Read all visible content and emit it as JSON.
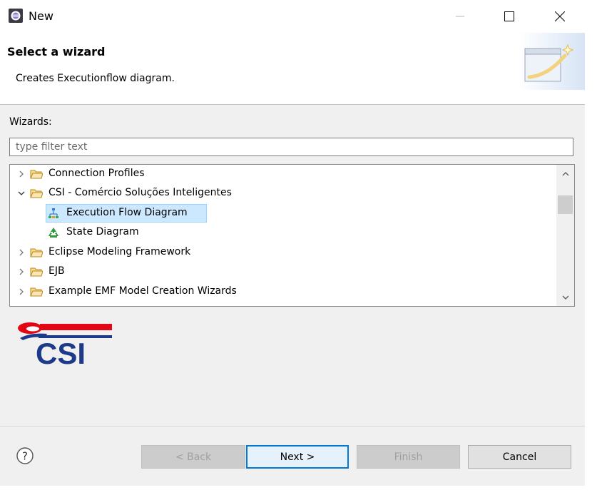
{
  "window": {
    "title": "New",
    "minimize_glyph": "—",
    "maximize_glyph": "☐",
    "close_glyph": "✕"
  },
  "header": {
    "title": "Select a wizard",
    "description": "Creates Executionflow diagram."
  },
  "wizards_label": "Wizards:",
  "filter": {
    "placeholder": "type filter text",
    "value": ""
  },
  "tree": {
    "items": [
      {
        "label": "Connection Profiles",
        "expanded": false,
        "icon": "folder-icon"
      },
      {
        "label": "CSI - Comércio Soluções Inteligentes",
        "expanded": true,
        "icon": "folder-icon"
      },
      {
        "label": "Execution Flow Diagram",
        "selected": true,
        "icon": "execution-flow-icon"
      },
      {
        "label": "State Diagram",
        "icon": "state-diagram-icon"
      },
      {
        "label": "Eclipse Modeling Framework",
        "expanded": false,
        "icon": "folder-icon"
      },
      {
        "label": "EJB",
        "expanded": false,
        "icon": "folder-icon"
      },
      {
        "label": "Example EMF Model Creation Wizards",
        "expanded": false,
        "icon": "folder-icon"
      }
    ]
  },
  "logo": {
    "text": "CSI"
  },
  "buttons": {
    "help_glyph": "?",
    "back": "< Back",
    "next": "Next >",
    "finish": "Finish",
    "cancel": "Cancel"
  },
  "colors": {
    "selection": "#cce8ff",
    "accent": "#0078d7",
    "csi_red": "#e30613",
    "csi_blue": "#1d3a8a"
  }
}
